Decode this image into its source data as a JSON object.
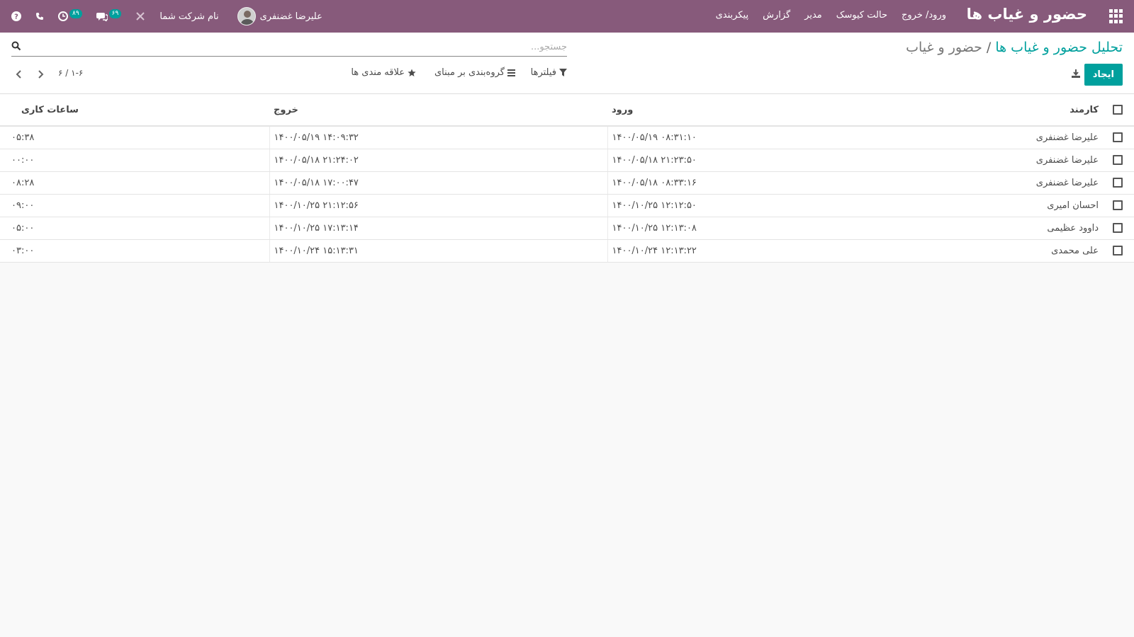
{
  "navbar": {
    "brand": "حضور و غیاب ها",
    "menu": [
      "ورود/ خروج",
      "حالت کیوسک",
      "مدیر",
      "گزارش",
      "پیکربندی"
    ],
    "user_name": "علیرضا غضنفری",
    "company_name": "نام شرکت شما",
    "activity_count": "۸۹",
    "messages_count": "۶۹"
  },
  "breadcrumb": {
    "parent": "تحلیل حضور و غیاب ها",
    "separator": "/",
    "current": "حضور و غیاب"
  },
  "search": {
    "placeholder": "جستجو..."
  },
  "buttons": {
    "create": "ایجاد",
    "filters": "فیلترها",
    "group_by": "گروه‌بندی بر مبنای",
    "favorites": "علاقه مندی ها"
  },
  "pager": {
    "value": "۱-۶ / ۶"
  },
  "table": {
    "columns": {
      "employee": "کارمند",
      "check_in": "ورود",
      "check_out": "خروج",
      "worked_hours": "ساعات کاری"
    },
    "rows": [
      {
        "employee": "علیرضا غضنفری",
        "check_in": "۱۴۰۰/۰۵/۱۹ ۰۸:۳۱:۱۰",
        "check_out": "۱۴۰۰/۰۵/۱۹ ۱۴:۰۹:۳۲",
        "worked_hours": "۰۵:۳۸"
      },
      {
        "employee": "علیرضا غضنفری",
        "check_in": "۱۴۰۰/۰۵/۱۸ ۲۱:۲۳:۵۰",
        "check_out": "۱۴۰۰/۰۵/۱۸ ۲۱:۲۴:۰۲",
        "worked_hours": "۰۰:۰۰"
      },
      {
        "employee": "علیرضا غضنفری",
        "check_in": "۱۴۰۰/۰۵/۱۸ ۰۸:۳۳:۱۶",
        "check_out": "۱۴۰۰/۰۵/۱۸ ۱۷:۰۰:۴۷",
        "worked_hours": "۰۸:۲۸"
      },
      {
        "employee": "احسان امیری",
        "check_in": "۱۴۰۰/۱۰/۲۵ ۱۲:۱۲:۵۰",
        "check_out": "۱۴۰۰/۱۰/۲۵ ۲۱:۱۲:۵۶",
        "worked_hours": "۰۹:۰۰"
      },
      {
        "employee": "داوود عظیمی",
        "check_in": "۱۴۰۰/۱۰/۲۵ ۱۲:۱۳:۰۸",
        "check_out": "۱۴۰۰/۱۰/۲۵ ۱۷:۱۳:۱۴",
        "worked_hours": "۰۵:۰۰"
      },
      {
        "employee": "علی محمدی",
        "check_in": "۱۴۰۰/۱۰/۲۴ ۱۲:۱۳:۲۲",
        "check_out": "۱۴۰۰/۱۰/۲۴ ۱۵:۱۳:۳۱",
        "worked_hours": "۰۳:۰۰"
      }
    ]
  },
  "colors": {
    "navbar": "#875a7b",
    "primary": "#00a09d",
    "background": "#f9f9f9"
  },
  "icons": [
    "apps-grid-icon",
    "help-icon",
    "phone-icon",
    "clock-icon",
    "chat-icon",
    "close-icon",
    "search-icon",
    "download-icon",
    "filter-icon",
    "group-by-icon",
    "star-icon",
    "chevron-left-icon",
    "chevron-right-icon"
  ]
}
